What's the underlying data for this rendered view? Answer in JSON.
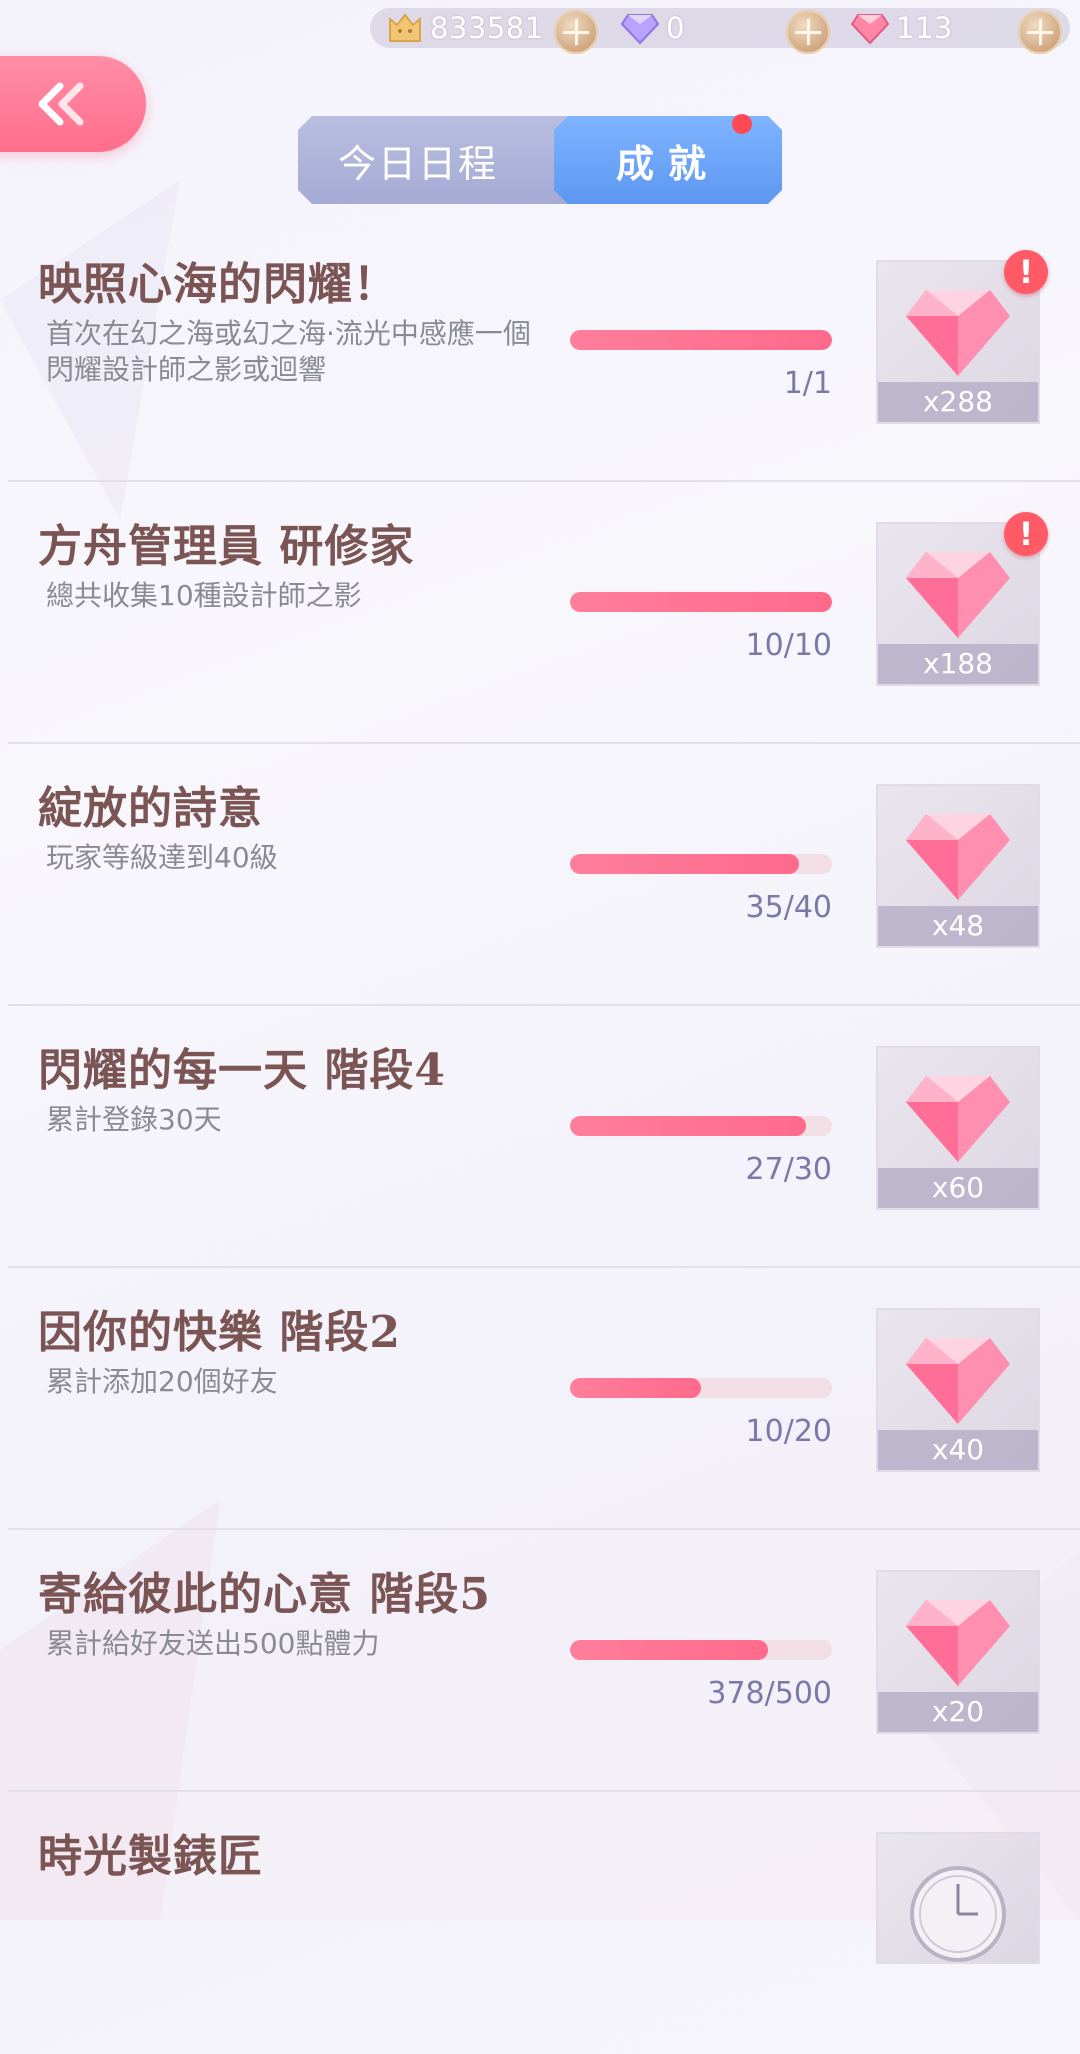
{
  "currencies": [
    {
      "icon": "cat-coin-icon",
      "value": "833581"
    },
    {
      "icon": "purple-diamond-icon",
      "value": "0"
    },
    {
      "icon": "pink-diamond-icon",
      "value": "113"
    }
  ],
  "tabs": {
    "today": "今日日程",
    "achievements": "成就"
  },
  "achievements": [
    {
      "title": "映照心海的閃耀！",
      "desc": "首次在幻之海或幻之海·流光中感應一個閃耀設計師之影或迴響",
      "progress": "1/1",
      "fraction": 1.0,
      "reward_qty": "x288",
      "alert": "!"
    },
    {
      "title": "方舟管理員 研修家",
      "desc": "總共收集10種設計師之影",
      "progress": "10/10",
      "fraction": 1.0,
      "reward_qty": "x188",
      "alert": "!"
    },
    {
      "title": "綻放的詩意",
      "desc": "玩家等級達到40級",
      "progress": "35/40",
      "fraction": 0.875,
      "reward_qty": "x48"
    },
    {
      "title": "閃耀的每一天 階段4",
      "desc": "累計登錄30天",
      "progress": "27/30",
      "fraction": 0.9,
      "reward_qty": "x60"
    },
    {
      "title": "因你的快樂 階段2",
      "desc": "累計添加20個好友",
      "progress": "10/20",
      "fraction": 0.5,
      "reward_qty": "x40"
    },
    {
      "title": "寄給彼此的心意  階段5",
      "desc": "累計給好友送出500點體力",
      "progress": "378/500",
      "fraction": 0.756,
      "reward_qty": "x20"
    },
    {
      "title": "時光製錶匠",
      "desc": "",
      "progress": "",
      "fraction": 0,
      "reward_qty": ""
    }
  ],
  "colors": {
    "accent": "#ff6d8c",
    "tab_active": "#5d97f2",
    "title": "#7b5454"
  }
}
